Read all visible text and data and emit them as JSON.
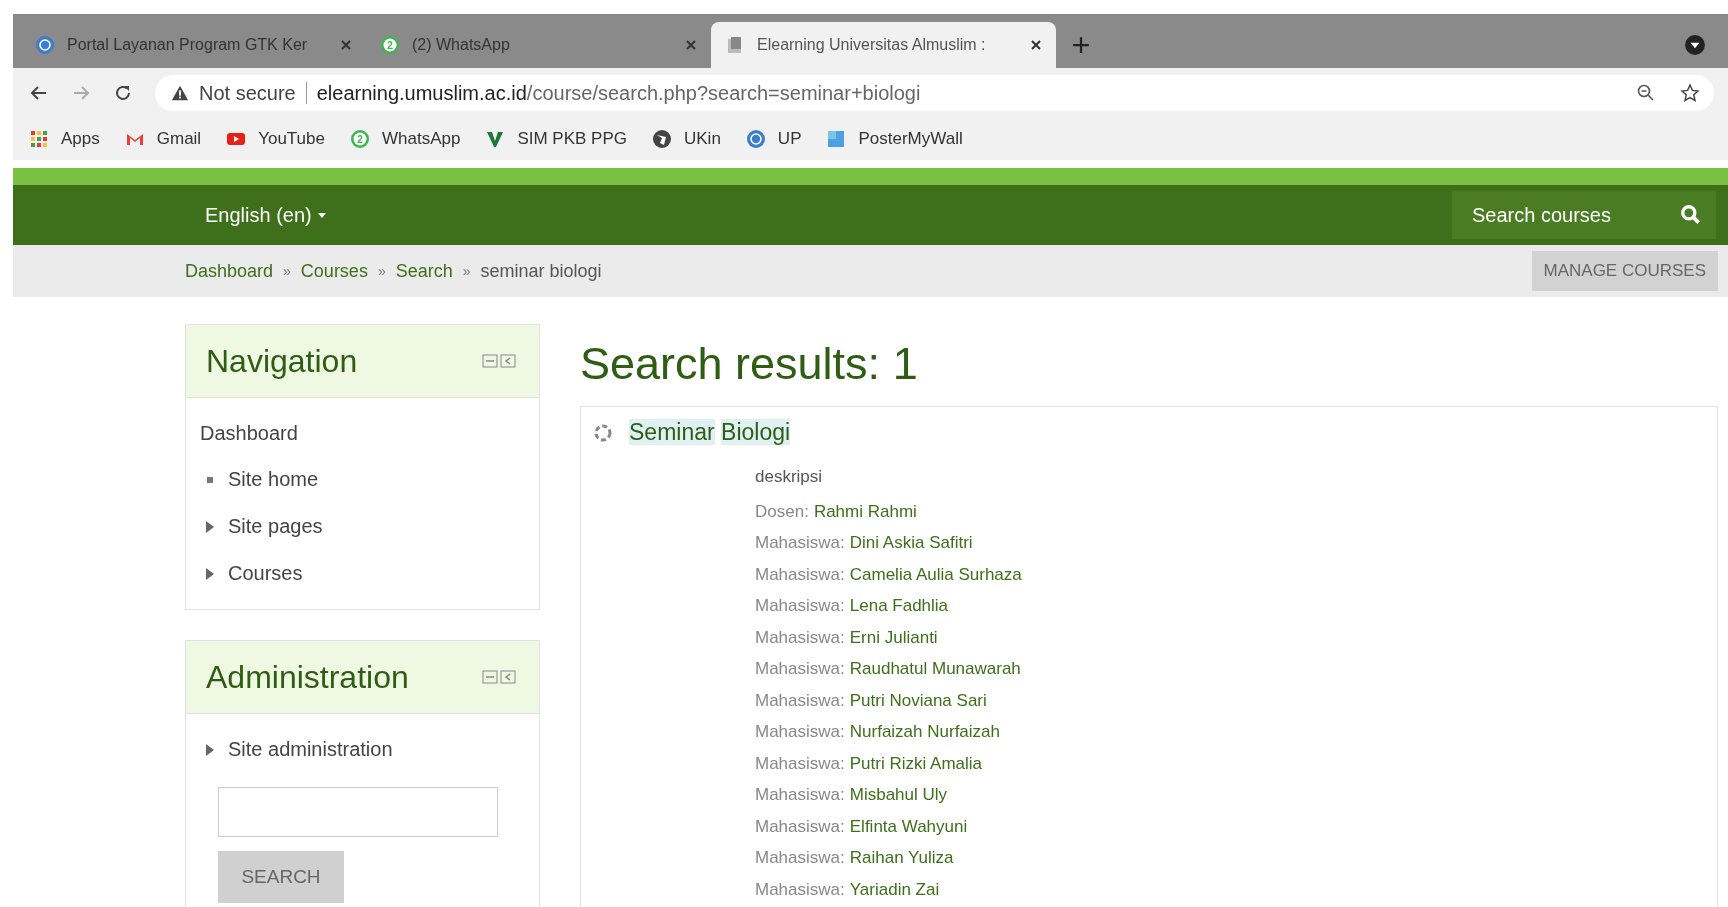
{
  "tabs": [
    {
      "title": "Portal Layanan Program GTK Ker",
      "kind": "globe",
      "selected": false
    },
    {
      "title": "(2) WhatsApp",
      "kind": "whatsapp",
      "badge": "2",
      "selected": false
    },
    {
      "title": "Elearning Universitas Almuslim :",
      "kind": "page",
      "selected": true
    }
  ],
  "address_bar": {
    "security": "Not secure",
    "host": "elearning.umuslim.ac.id",
    "path": "/course/search.php?search=seminar+biologi"
  },
  "bookmarks": [
    {
      "label": "Apps",
      "kind": "apps"
    },
    {
      "label": "Gmail",
      "kind": "gmail"
    },
    {
      "label": "YouTube",
      "kind": "youtube"
    },
    {
      "label": "WhatsApp",
      "kind": "whatsapp",
      "badge": "2"
    },
    {
      "label": "SIM PKB PPG",
      "kind": "v"
    },
    {
      "label": "UKin",
      "kind": "globe-dark"
    },
    {
      "label": "UP",
      "kind": "globe"
    },
    {
      "label": "PosterMyWall",
      "kind": "square"
    }
  ],
  "navbar": {
    "language": "English (en)",
    "search_placeholder": "Search courses"
  },
  "breadcrumb": {
    "items": [
      "Dashboard",
      "Courses",
      "Search"
    ],
    "separator": "»",
    "current": "seminar biologi",
    "button": "MANAGE COURSES"
  },
  "navigation_block": {
    "title": "Navigation",
    "root": "Dashboard",
    "items": [
      {
        "label": "Site home",
        "kind": "leaf"
      },
      {
        "label": "Site pages",
        "kind": "branch"
      },
      {
        "label": "Courses",
        "kind": "branch"
      }
    ]
  },
  "administration_block": {
    "title": "Administration",
    "items": [
      {
        "label": "Site administration",
        "kind": "branch"
      }
    ],
    "search_button": "SEARCH"
  },
  "results": {
    "title": "Search results: 1",
    "course": {
      "words": [
        {
          "text": "Seminar",
          "highlighted": true
        },
        {
          "text": "Biologi",
          "highlighted": true
        }
      ],
      "summary": "deskripsi",
      "contacts": [
        {
          "role": "Dosen:",
          "name": "Rahmi Rahmi"
        },
        {
          "role": "Mahasiswa:",
          "name": "Dini Askia Safitri"
        },
        {
          "role": "Mahasiswa:",
          "name": "Camelia Aulia Surhaza"
        },
        {
          "role": "Mahasiswa:",
          "name": "Lena Fadhlia"
        },
        {
          "role": "Mahasiswa:",
          "name": "Erni Julianti"
        },
        {
          "role": "Mahasiswa:",
          "name": "Raudhatul Munawarah"
        },
        {
          "role": "Mahasiswa:",
          "name": "Putri Noviana Sari"
        },
        {
          "role": "Mahasiswa:",
          "name": "Nurfaizah Nurfaizah"
        },
        {
          "role": "Mahasiswa:",
          "name": "Putri Rizki Amalia"
        },
        {
          "role": "Mahasiswa:",
          "name": "Misbahul Uly"
        },
        {
          "role": "Mahasiswa:",
          "name": "Elfinta Wahyuni"
        },
        {
          "role": "Mahasiswa:",
          "name": "Raihan Yuliza"
        },
        {
          "role": "Mahasiswa:",
          "name": "Yariadin Zai"
        }
      ]
    }
  }
}
